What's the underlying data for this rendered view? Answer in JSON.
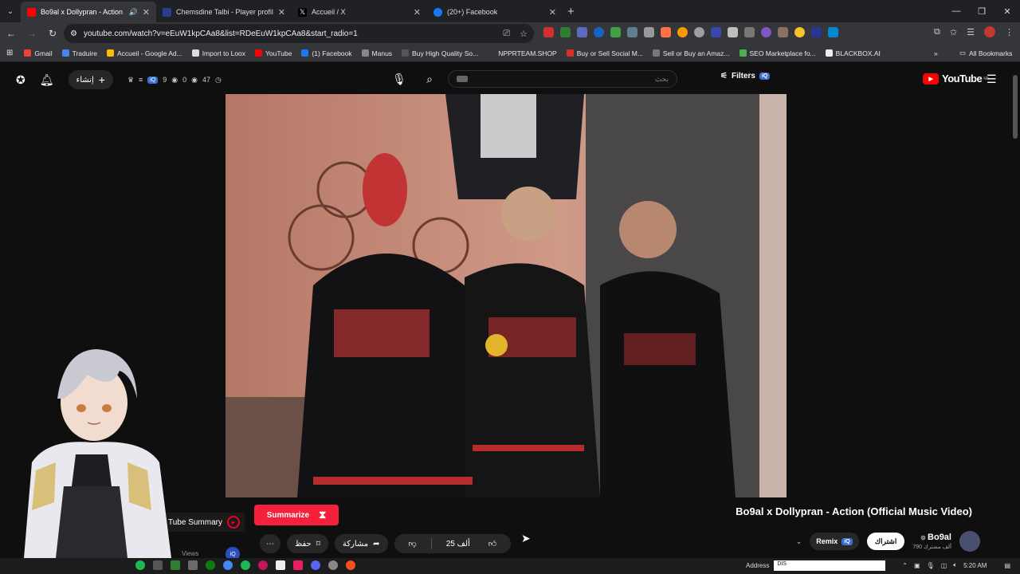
{
  "browser": {
    "tabs": [
      {
        "title": "Bo9al x Dollypran - Action (",
        "color": "#ff0000",
        "active": true,
        "audio": "🔊"
      },
      {
        "title": "Chemsdine Talbi - Player profile",
        "color": "#2a3d8f",
        "active": false
      },
      {
        "title": "Accueil / X",
        "color": "#222222",
        "active": false
      },
      {
        "title": "(20+) Facebook",
        "color": "#1877f2",
        "active": false
      }
    ],
    "url": "youtube.com/watch?v=eEuW1kpCAa8&list=RDeEuW1kpCAa8&start_radio=1",
    "bookmarks": [
      {
        "label": "Gmail",
        "color": "#ea4335"
      },
      {
        "label": "Traduire",
        "color": "#4285f4"
      },
      {
        "label": "Accueil - Google Ad...",
        "color": "#fbbc05"
      },
      {
        "label": "Import to Loox",
        "color": "#dddddd"
      },
      {
        "label": "YouTube",
        "color": "#ff0000"
      },
      {
        "label": "(1) Facebook",
        "color": "#1877f2"
      },
      {
        "label": "Manus",
        "color": "#888888"
      },
      {
        "label": "Buy High Quality So...",
        "color": "#555555"
      },
      {
        "label": "NPPRTEAM.SHOP",
        "color": "#35363a"
      },
      {
        "label": "Buy or Sell Social M...",
        "color": "#d93025"
      },
      {
        "label": "Sell or Buy an Amaz...",
        "color": "#777777"
      },
      {
        "label": "SEO Marketplace fo...",
        "color": "#4caf50"
      },
      {
        "label": "BLACKBOX.AI",
        "color": "#eeeeee"
      }
    ],
    "all_bookmarks": "All Bookmarks"
  },
  "yt": {
    "create_label": "إنشاء",
    "stats": {
      "a": "9",
      "b": "0",
      "c": "47"
    },
    "search_placeholder": "بحث",
    "filters_label": "Filters",
    "iq": "iQ",
    "logo_text": "YouTube",
    "logo_sup": "MA"
  },
  "video": {
    "title": "Bo9al x Dollypran - Action (Official Music Video)",
    "summary_label": "Tube Summary",
    "summarize_label": "Summarize",
    "views_label": "Views",
    "likes": "25 ألف",
    "share_label": "مشاركة",
    "save_label": "حفظ",
    "more_label": "⋯"
  },
  "channel": {
    "name": "Bo9al",
    "subs": "790 ألف مشترك",
    "subscribe_label": "اشتراك",
    "remix_label": "Remix"
  },
  "taskbar": {
    "address_label": "Address",
    "address_value": "DIS",
    "time": "5:20 AM"
  }
}
